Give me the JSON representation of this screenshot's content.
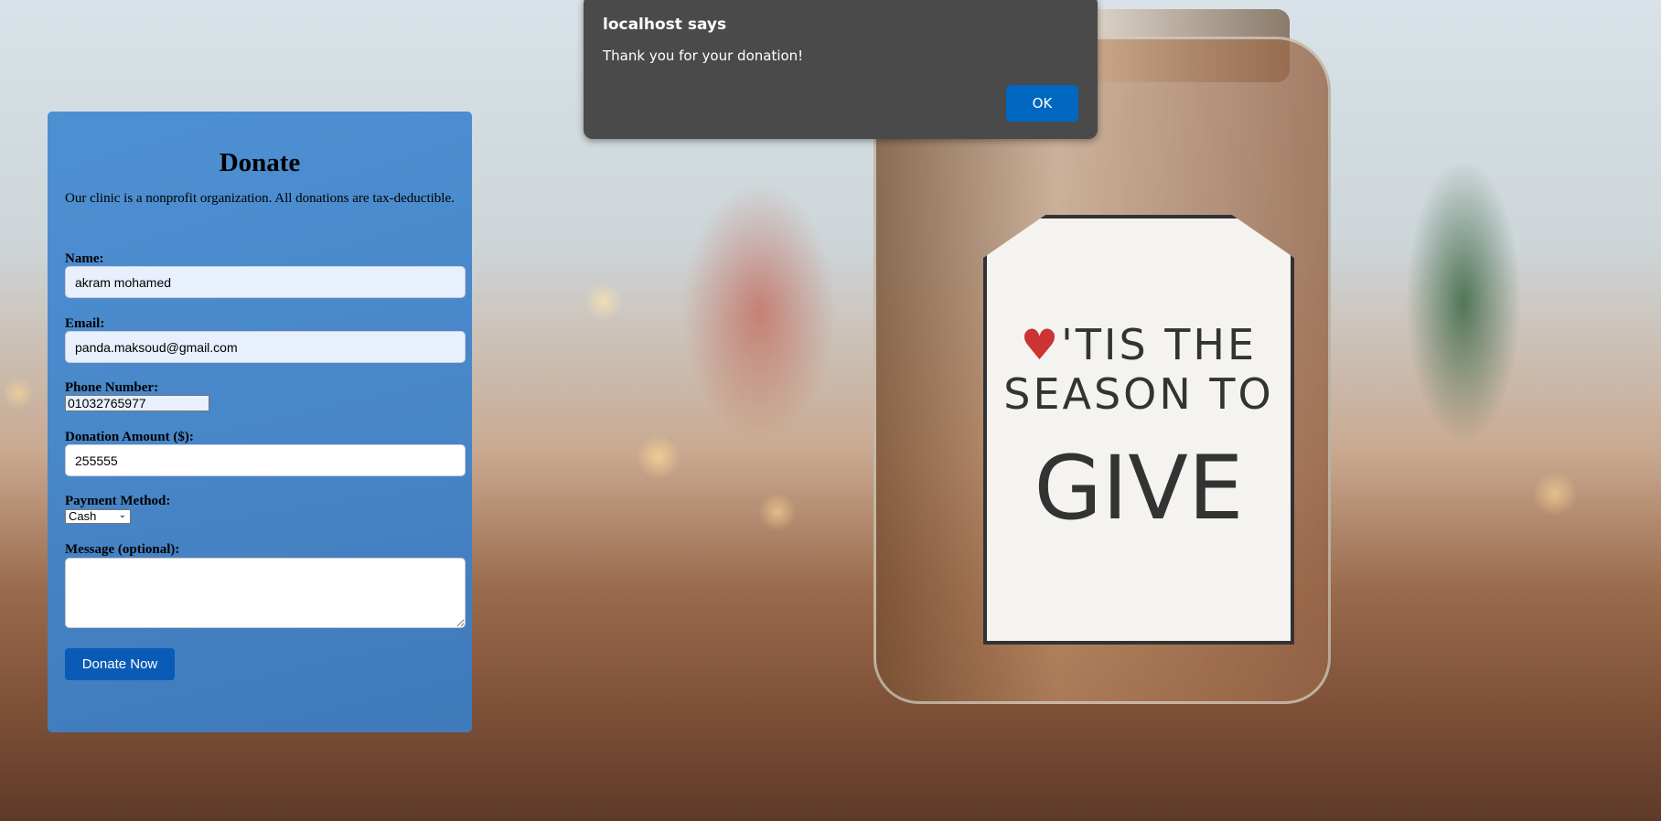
{
  "background": {
    "tag_text": [
      "'TIS THE",
      "SEASON TO",
      "GIVE"
    ]
  },
  "form": {
    "title": "Donate",
    "intro": "Our clinic is a nonprofit organization. All donations are tax-deductible.",
    "name_label": "Name:",
    "name_value": "akram mohamed",
    "email_label": "Email:",
    "email_value": "panda.maksoud@gmail.com",
    "phone_label": "Phone Number:",
    "phone_value": "01032765977",
    "amount_label": "Donation Amount ($):",
    "amount_value": "255555",
    "payment_label": "Payment Method:",
    "payment_value": "Cash",
    "message_label": "Message (optional):",
    "message_value": "",
    "submit_label": "Donate Now"
  },
  "dialog": {
    "title": "localhost says",
    "message": "Thank you for your donation!",
    "ok_label": "OK"
  }
}
